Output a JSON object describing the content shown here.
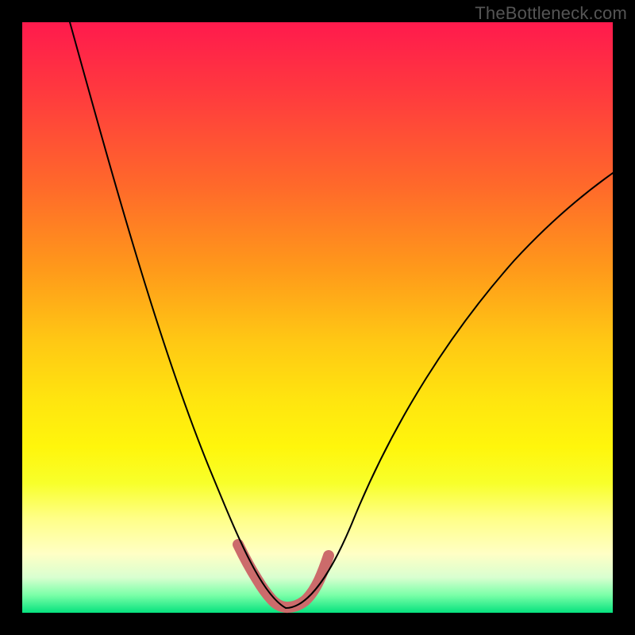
{
  "watermark": "TheBottleneck.com",
  "colors": {
    "background": "#000000",
    "curve": "#000000",
    "highlight": "#cc6b6b",
    "watermark_text": "#555555"
  },
  "chart_data": {
    "type": "line",
    "title": "",
    "xlabel": "",
    "ylabel": "",
    "xlim": [
      0,
      100
    ],
    "ylim": [
      0,
      100
    ],
    "x": [
      0,
      5,
      10,
      15,
      20,
      25,
      30,
      33,
      36,
      39,
      41,
      43,
      45,
      47,
      50,
      55,
      60,
      65,
      70,
      75,
      80,
      85,
      90,
      95,
      100
    ],
    "y": [
      100,
      86,
      72,
      59,
      46,
      34,
      22,
      15,
      9,
      4,
      1,
      0,
      0,
      1,
      4,
      11,
      19,
      27,
      34,
      41,
      48,
      54,
      60,
      65,
      70
    ],
    "highlight_range_x": [
      36,
      50
    ],
    "annotations": [],
    "grid": false,
    "legend": null
  }
}
